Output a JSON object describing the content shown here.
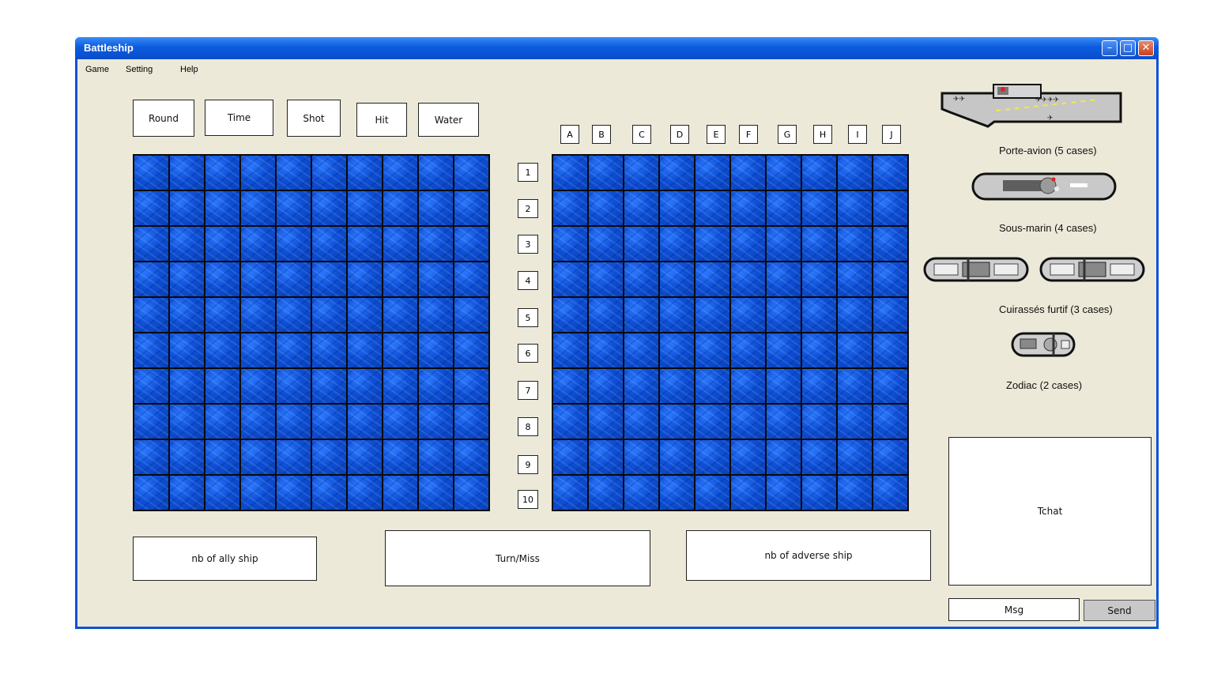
{
  "window": {
    "title": "Battleship",
    "controls": [
      "minimize",
      "maximize",
      "close"
    ]
  },
  "menu": [
    "Game",
    "Setting",
    "Help"
  ],
  "stats": {
    "round": "Round",
    "time": "Time",
    "shot": "Shot",
    "hit": "Hit",
    "water": "Water"
  },
  "columns": [
    "A",
    "B",
    "C",
    "D",
    "E",
    "F",
    "G",
    "H",
    "I",
    "J"
  ],
  "rows": [
    "1",
    "2",
    "3",
    "4",
    "5",
    "6",
    "7",
    "8",
    "9",
    "10"
  ],
  "ships": {
    "carrier": "Porte-avion (5 cases)",
    "submarine": "Sous-marin (4 cases)",
    "stealth": "Cuirassés furtif (3 cases)",
    "zodiac": "Zodiac (2 cases)"
  },
  "bottom": {
    "ally": "nb of ally ship",
    "turn": "Turn/Miss",
    "adverse": "nb of adverse ship"
  },
  "chat": {
    "panel": "Tchat",
    "input": "Msg",
    "send": "Send"
  },
  "colors": {
    "water": "#0d4fd6",
    "titlebar": "#0B5BDD",
    "window_bg": "#ECE9D8"
  }
}
